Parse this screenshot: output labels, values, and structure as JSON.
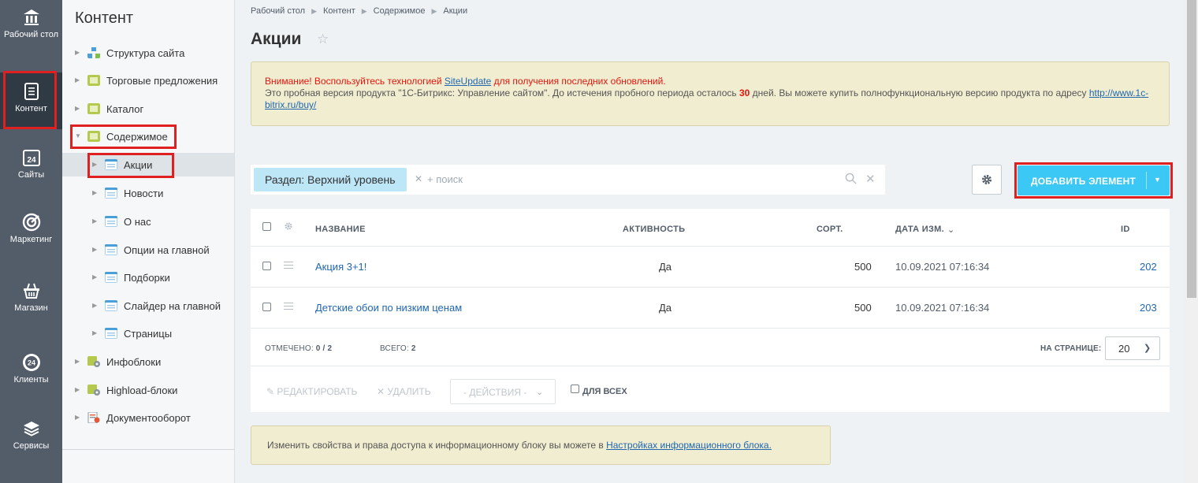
{
  "leftnav": {
    "items": [
      {
        "label": "Рабочий стол",
        "icon": "home-icon"
      },
      {
        "label": "Контент",
        "icon": "document-icon"
      },
      {
        "label": "Сайты",
        "icon": "calendar-24-icon"
      },
      {
        "label": "Маркетинг",
        "icon": "target-icon"
      },
      {
        "label": "Магазин",
        "icon": "basket-icon"
      },
      {
        "label": "Клиенты",
        "icon": "clients-24-icon"
      },
      {
        "label": "Сервисы",
        "icon": "layers-icon"
      }
    ]
  },
  "submenu": {
    "title": "Контент",
    "items": [
      {
        "label": "Структура сайта"
      },
      {
        "label": "Торговые предложения"
      },
      {
        "label": "Каталог"
      },
      {
        "label": "Содержимое"
      },
      {
        "label": "Акции"
      },
      {
        "label": "Новости"
      },
      {
        "label": "О нас"
      },
      {
        "label": "Опции на главной"
      },
      {
        "label": "Подборки"
      },
      {
        "label": "Слайдер на главной"
      },
      {
        "label": "Страницы"
      },
      {
        "label": "Инфоблоки"
      },
      {
        "label": "Highload-блоки"
      },
      {
        "label": "Документооборот"
      }
    ]
  },
  "breadcrumb": [
    "Рабочий стол",
    "Контент",
    "Содержимое",
    "Акции"
  ],
  "page": {
    "title": "Акции"
  },
  "notice": {
    "warn_prefix": "Внимание! Воспользуйтесь технологией ",
    "siteupdate_link": "SiteUpdate",
    "warn_suffix": " для получения последних обновлений.",
    "trial_text": "Это пробная версия продукта \"1С-Битрикс: Управление сайтом\". До истечения пробного периода осталось ",
    "days": "30",
    "trial_suffix": " дней. Вы можете купить полнофункциональную версию продукта по адресу ",
    "buy_link": "http://www.1c-bitrix.ru/buy/"
  },
  "filter": {
    "tag": "Раздел: Верхний уровень",
    "search_placeholder": "+ поиск"
  },
  "toolbar": {
    "add_label": "ДОБАВИТЬ ЭЛЕМЕНТ"
  },
  "grid": {
    "columns": {
      "name": "НАЗВАНИЕ",
      "active": "АКТИВНОСТЬ",
      "sort": "СОРТ.",
      "date": "ДАТА ИЗМ.",
      "id": "ID"
    },
    "rows": [
      {
        "name": "Акция 3+1!",
        "active": "Да",
        "sort": "500",
        "date": "10.09.2021 07:16:34",
        "id": "202"
      },
      {
        "name": "Детские обои по низким ценам",
        "active": "Да",
        "sort": "500",
        "date": "10.09.2021 07:16:34",
        "id": "203"
      }
    ],
    "footer": {
      "selected_label": "ОТМЕЧЕНО:",
      "selected_value": "0 / 2",
      "total_label": "ВСЕГО:",
      "total_value": "2",
      "perpage_label": "НА СТРАНИЦЕ:",
      "perpage_value": "20"
    },
    "actions": {
      "edit": "РЕДАКТИРОВАТЬ",
      "delete": "УДАЛИТЬ",
      "select": "- ДЕЙСТВИЯ -",
      "forall": "ДЛЯ ВСЕХ"
    }
  },
  "bottom_note": {
    "text": "Изменить свойства и права доступа к информационному блоку вы можете в ",
    "link": "Настройках информационного блока."
  },
  "colors": {
    "accent": "#3bc8f5",
    "nav_bg": "#535c69",
    "highlight": "#e02020"
  }
}
